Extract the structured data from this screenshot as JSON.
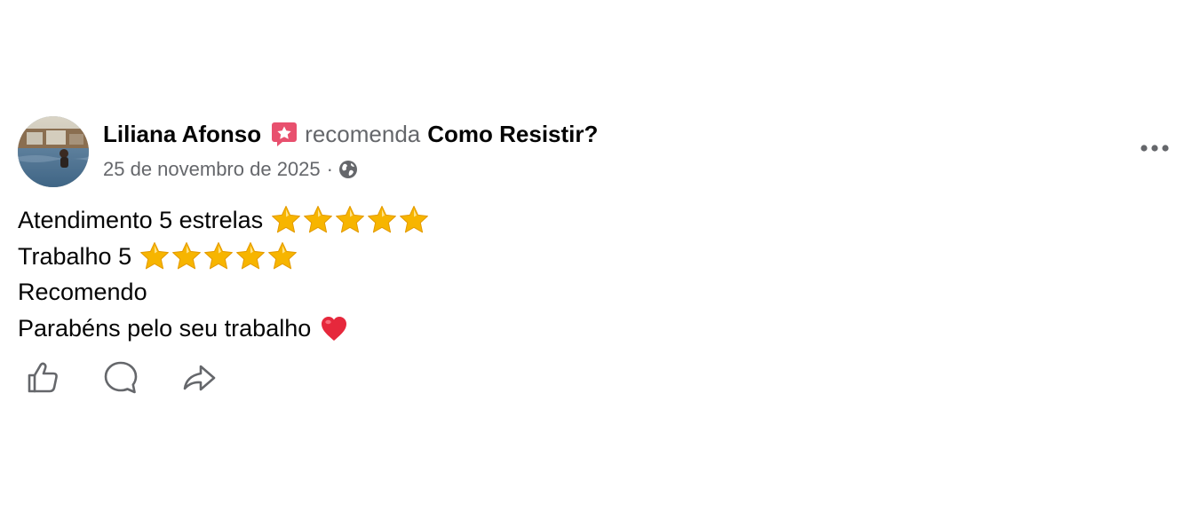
{
  "post": {
    "author": "Liliana Afonso",
    "action": "recomenda",
    "page": "Como Resistir?",
    "date": "25 de novembro de 2025",
    "separator": "·",
    "audience_icon": "globe-icon",
    "recommend_badge_icon": "recommend-star-icon",
    "more_icon": "more-horizontal-icon"
  },
  "body": {
    "lines": [
      {
        "text": "Atendimento 5 estrelas",
        "emoji": "star",
        "emoji_count": 5
      },
      {
        "text": "Trabalho 5",
        "emoji": "star",
        "emoji_count": 5
      },
      {
        "text": "Recomendo",
        "emoji": "",
        "emoji_count": 0
      },
      {
        "text": "Parabéns pelo seu trabalho",
        "emoji": "red-heart",
        "emoji_count": 1
      }
    ]
  },
  "actions": {
    "like_icon": "like-icon",
    "comment_icon": "comment-icon",
    "share_icon": "share-icon"
  },
  "colors": {
    "text": "#050505",
    "secondary_text": "#65676b",
    "badge": "#e8506e",
    "star": "#f7b500",
    "heart": "#e6283c"
  }
}
